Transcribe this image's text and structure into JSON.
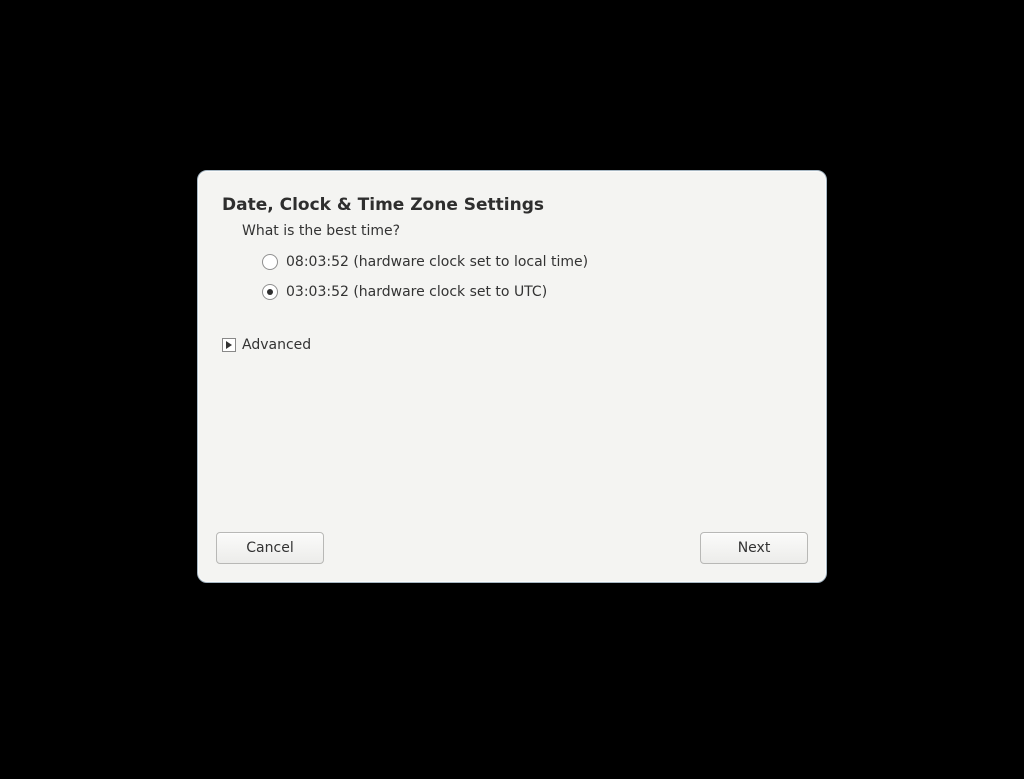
{
  "dialog": {
    "title": "Date, Clock & Time Zone Settings",
    "prompt": "What is the best time?",
    "options": [
      {
        "label": "08:03:52 (hardware clock set to local time)",
        "selected": false
      },
      {
        "label": "03:03:52 (hardware clock set to UTC)",
        "selected": true
      }
    ],
    "advanced_label": "Advanced",
    "buttons": {
      "cancel": "Cancel",
      "next": "Next"
    }
  }
}
